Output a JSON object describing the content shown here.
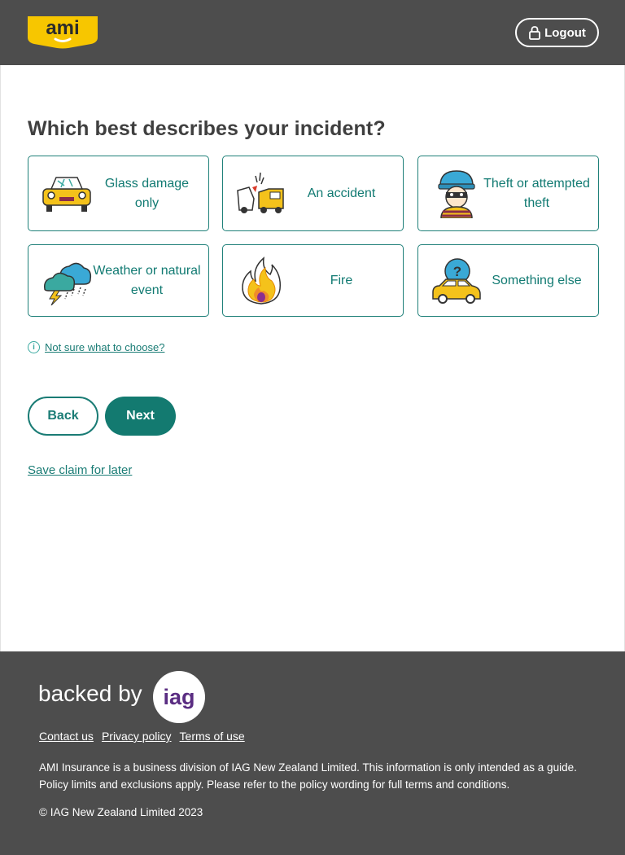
{
  "header": {
    "logo_text": "ami",
    "logout_label": "Logout"
  },
  "main": {
    "question": "Which best describes your incident?",
    "options": [
      {
        "label": "Glass damage only",
        "icon": "car-glass-icon"
      },
      {
        "label": "An accident",
        "icon": "car-accident-icon"
      },
      {
        "label": "Theft or attempted theft",
        "icon": "thief-icon"
      },
      {
        "label": "Weather or natural event",
        "icon": "storm-cloud-icon"
      },
      {
        "label": "Fire",
        "icon": "fire-icon"
      },
      {
        "label": "Something else",
        "icon": "car-question-icon"
      }
    ],
    "help_link": "Not sure what to choose?",
    "back_label": "Back",
    "next_label": "Next",
    "save_link": "Save claim for later"
  },
  "footer": {
    "backed_by": "backed by",
    "iag_text": "iag",
    "links": [
      "Contact us",
      "Privacy policy",
      "Terms of use"
    ],
    "disclaimer": "AMI Insurance is a business division of IAG New Zealand Limited. This information is only intended as a guide. Policy limits and exclusions apply. Please refer to the policy wording for full terms and conditions.",
    "copyright": "© IAG New Zealand Limited 2023"
  },
  "colors": {
    "header_bg": "#4d4d4d",
    "accent_teal": "#137a70",
    "logo_yellow": "#f7c600",
    "iag_purple": "#5a2d82"
  }
}
